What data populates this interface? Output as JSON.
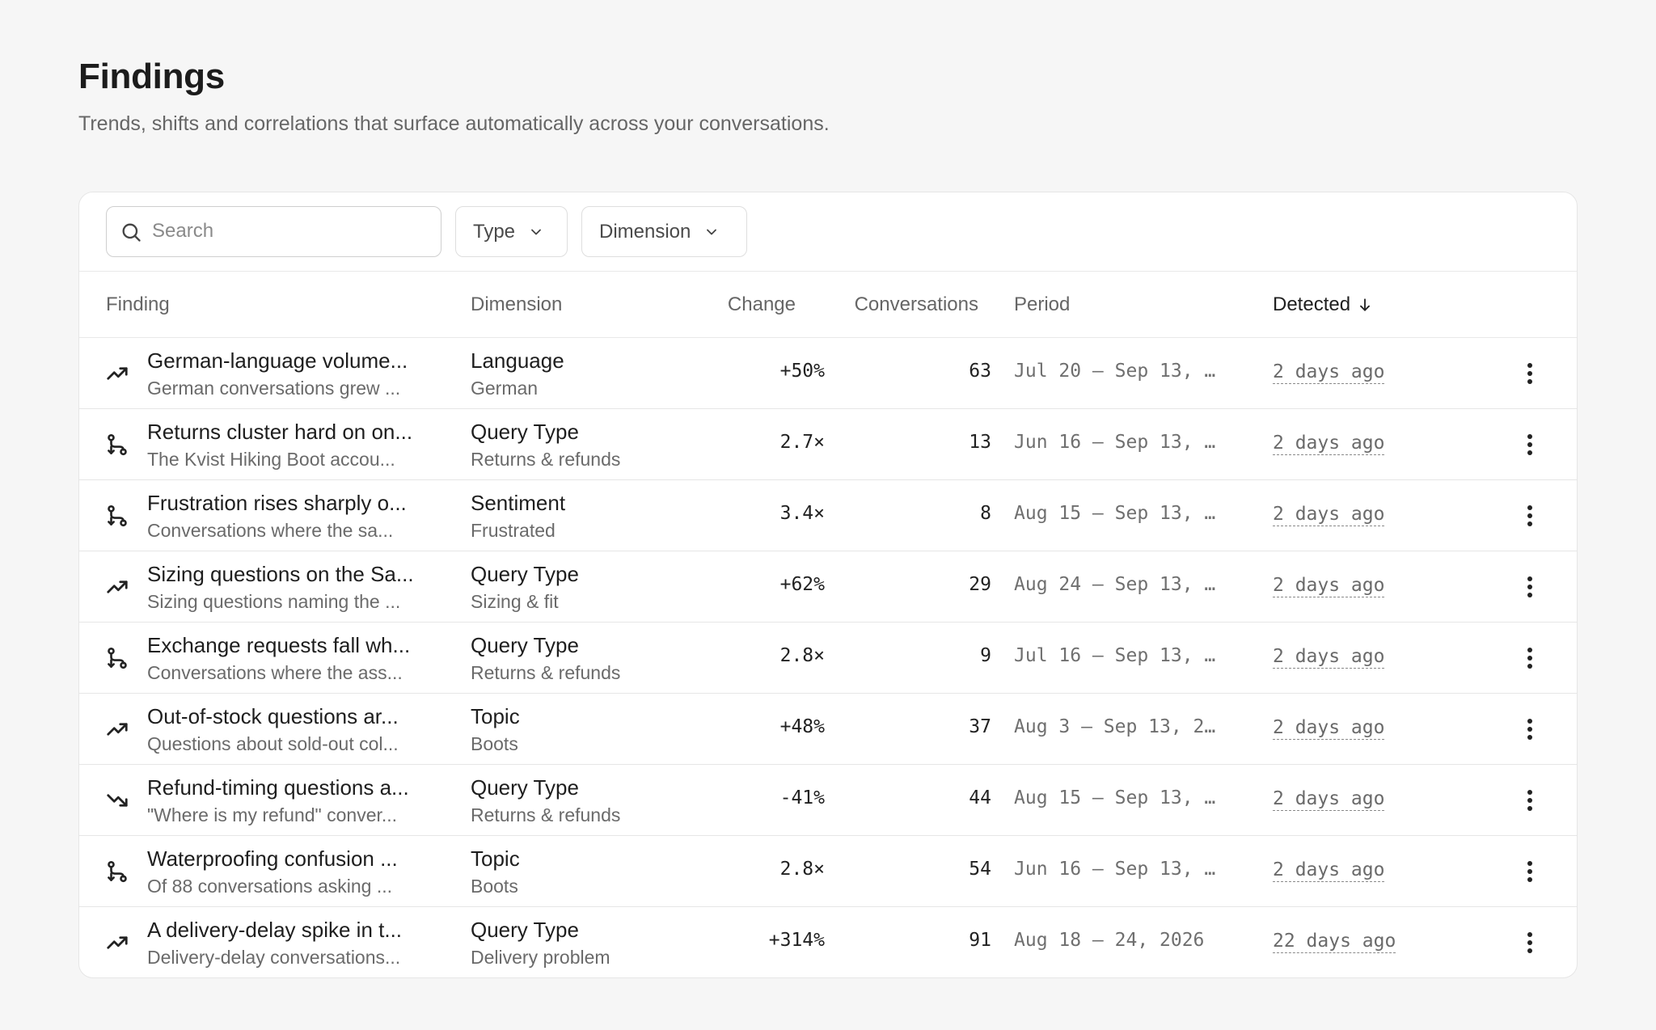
{
  "header": {
    "title": "Findings",
    "subtitle": "Trends, shifts and correlations that surface automatically across your conversations."
  },
  "toolbar": {
    "search_placeholder": "Search",
    "filter_type": "Type",
    "filter_dimension": "Dimension"
  },
  "table": {
    "columns": {
      "finding": "Finding",
      "dimension": "Dimension",
      "change": "Change",
      "conversations": "Conversations",
      "period": "Period",
      "detected": "Detected"
    },
    "rows": [
      {
        "icon": "trend-up-icon",
        "title": "German-language volume...",
        "desc": "German conversations grew ...",
        "dimension": "Language",
        "value": "German",
        "change": "+50%",
        "conversations": "63",
        "period": "Jul 20 – Sep 13, …",
        "detected": "2 days ago"
      },
      {
        "icon": "correlation-icon",
        "title": "Returns cluster hard on on...",
        "desc": "The Kvist Hiking Boot accou...",
        "dimension": "Query Type",
        "value": "Returns & refunds",
        "change": "2.7×",
        "conversations": "13",
        "period": "Jun 16 – Sep 13, …",
        "detected": "2 days ago"
      },
      {
        "icon": "correlation-icon",
        "title": "Frustration rises sharply o...",
        "desc": "Conversations where the sa...",
        "dimension": "Sentiment",
        "value": "Frustrated",
        "change": "3.4×",
        "conversations": "8",
        "period": "Aug 15 – Sep 13, …",
        "detected": "2 days ago"
      },
      {
        "icon": "trend-up-icon",
        "title": "Sizing questions on the Sa...",
        "desc": "Sizing questions naming the ...",
        "dimension": "Query Type",
        "value": "Sizing & fit",
        "change": "+62%",
        "conversations": "29",
        "period": "Aug 24 – Sep 13, …",
        "detected": "2 days ago"
      },
      {
        "icon": "correlation-icon",
        "title": "Exchange requests fall wh...",
        "desc": "Conversations where the ass...",
        "dimension": "Query Type",
        "value": "Returns & refunds",
        "change": "2.8×",
        "conversations": "9",
        "period": "Jul 16 – Sep 13, …",
        "detected": "2 days ago"
      },
      {
        "icon": "trend-up-icon",
        "title": "Out-of-stock questions ar...",
        "desc": "Questions about sold-out col...",
        "dimension": "Topic",
        "value": "Boots",
        "change": "+48%",
        "conversations": "37",
        "period": "Aug 3 – Sep 13, 2…",
        "detected": "2 days ago"
      },
      {
        "icon": "trend-down-icon",
        "title": "Refund-timing questions a...",
        "desc": "\"Where is my refund\" conver...",
        "dimension": "Query Type",
        "value": "Returns & refunds",
        "change": "-41%",
        "conversations": "44",
        "period": "Aug 15 – Sep 13, …",
        "detected": "2 days ago"
      },
      {
        "icon": "correlation-icon",
        "title": "Waterproofing confusion ...",
        "desc": "Of 88 conversations asking ...",
        "dimension": "Topic",
        "value": "Boots",
        "change": "2.8×",
        "conversations": "54",
        "period": "Jun 16 – Sep 13, …",
        "detected": "2 days ago"
      },
      {
        "icon": "trend-up-icon",
        "title": "A delivery-delay spike in t...",
        "desc": "Delivery-delay conversations...",
        "dimension": "Query Type",
        "value": "Delivery problem",
        "change": "+314%",
        "conversations": "91",
        "period": "Aug 18 – 24, 2026",
        "detected": "22 days ago"
      }
    ]
  }
}
